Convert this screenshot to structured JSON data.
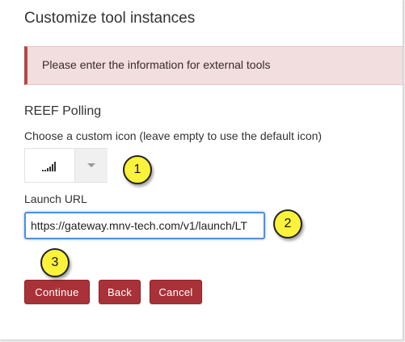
{
  "header": {
    "title": "Customize tool instances"
  },
  "alert": {
    "message": "Please enter the information for external tools"
  },
  "tool": {
    "name": "REEF Polling",
    "icon_label": "Choose a custom icon (leave empty to use the default icon)",
    "icon_name": "signal-bars-icon",
    "launch_label": "Launch URL",
    "launch_url": "https://gateway.mnv-tech.com/v1/launch/LT"
  },
  "actions": {
    "continue_label": "Continue",
    "back_label": "Back",
    "cancel_label": "Cancel"
  },
  "callouts": [
    "1",
    "2",
    "3"
  ],
  "colors": {
    "button": "#a93238",
    "alert_bg": "#f2dede",
    "alert_border": "#b9464a",
    "focus": "#4f8fde",
    "callout": "#fbf23b"
  }
}
